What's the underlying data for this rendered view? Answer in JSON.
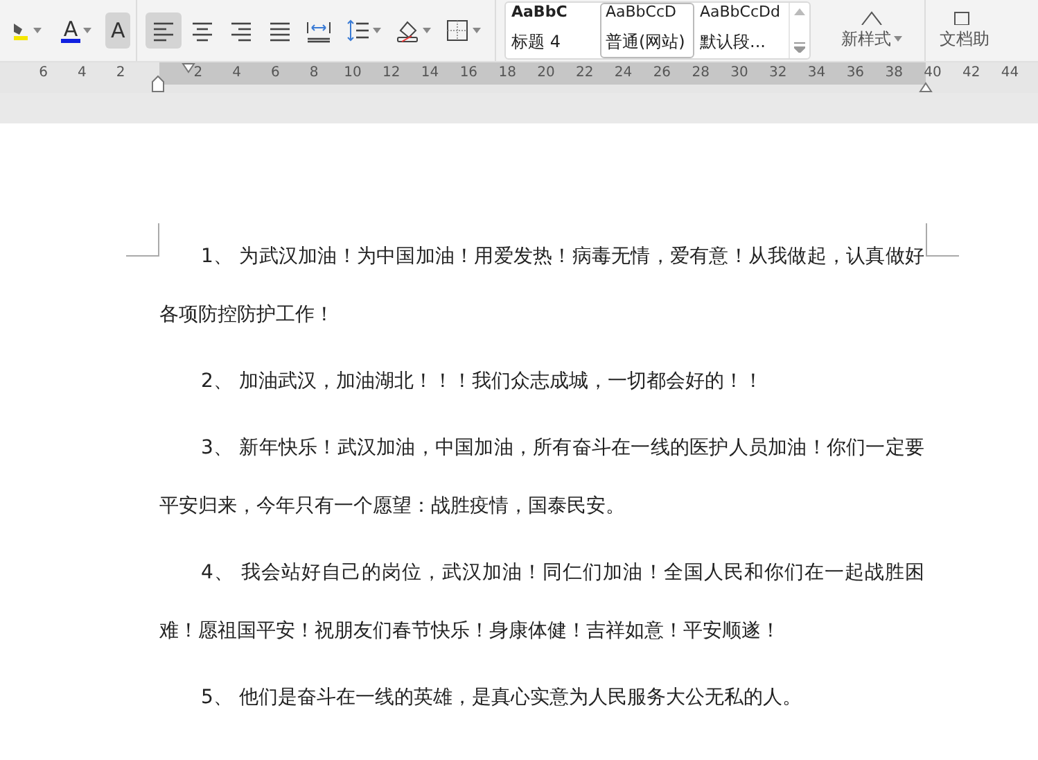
{
  "toolbar": {
    "font_group": [
      {
        "kind": "highlight",
        "selected": false
      },
      {
        "kind": "font-color",
        "label": "A",
        "selected": false
      },
      {
        "kind": "char-shading",
        "label": "A",
        "selected": true
      }
    ],
    "paragraph_group": [
      {
        "kind": "align-left",
        "selected": true
      },
      {
        "kind": "align-center",
        "selected": false
      },
      {
        "kind": "align-right",
        "selected": false
      },
      {
        "kind": "justify",
        "selected": false
      },
      {
        "kind": "distribute",
        "selected": false
      },
      {
        "kind": "line-spacing",
        "selected": false
      },
      {
        "kind": "shading",
        "selected": false
      },
      {
        "kind": "borders",
        "selected": false
      }
    ],
    "styles": [
      {
        "preview": "AaBbC",
        "name": "标题 4",
        "selected": false
      },
      {
        "preview": "AaBbCcD",
        "name": "普通(网站)",
        "selected": true
      },
      {
        "preview": "AaBbCcDd",
        "name": "默认段...",
        "selected": false
      }
    ],
    "new_style": "新样式",
    "doc_helper": "文档助"
  },
  "ruler": {
    "left_labels": [
      "6",
      "4",
      "2"
    ],
    "right_labels": [
      "2",
      "4",
      "6",
      "8",
      "10",
      "12",
      "14",
      "16",
      "18",
      "20",
      "22",
      "24",
      "26",
      "28",
      "30",
      "32",
      "34",
      "36",
      "38",
      "40",
      "42",
      "44"
    ]
  },
  "paragraphs": [
    "1、 为武汉加油！为中国加油！用爱发热！病毒无情，爱有意！从我做起，认真做好各项防控防护工作！",
    "2、 加油武汉，加油湖北！！！我们众志成城，一切都会好的！！",
    "3、 新年快乐！武汉加油，中国加油，所有奋斗在一线的医护人员加油！你们一定要平安归来，今年只有一个愿望：战胜疫情，国泰民安。",
    "4、 我会站好自己的岗位，武汉加油！同仁们加油！全国人民和你们在一起战胜困难！愿祖国平安！祝朋友们春节快乐！身康体健！吉祥如意！平安顺遂！",
    "5、 他们是奋斗在一线的英雄，是真心实意为人民服务大公无私的人。"
  ]
}
